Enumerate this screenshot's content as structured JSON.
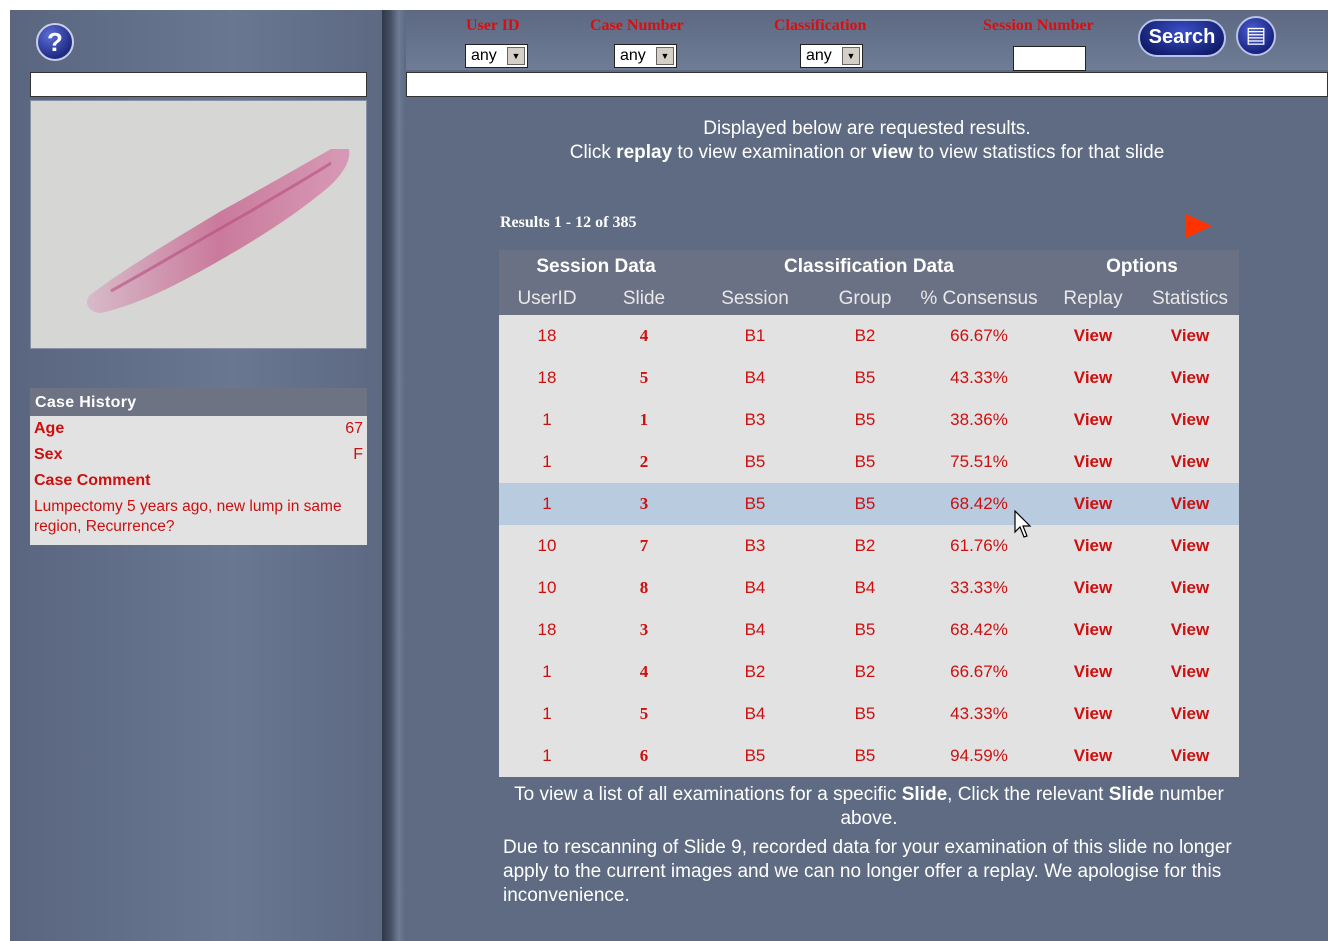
{
  "filters": {
    "user_id_label": "User ID",
    "case_number_label": "Case Number",
    "classification_label": "Classification",
    "session_number_label": "Session Number",
    "user_id_value": "any",
    "case_number_value": "any",
    "classification_value": "any",
    "search_label": "Search"
  },
  "intro": {
    "line1": "Displayed below are requested results.",
    "line2_pre": "Click ",
    "replay_word": "replay",
    "line2_mid": " to view examination or ",
    "view_word": "view",
    "line2_post": " to view statistics for that slide"
  },
  "results_count": "Results 1 - 12 of 385",
  "table": {
    "group_headers": [
      "Session Data",
      "Classification Data",
      "Options"
    ],
    "columns": [
      "UserID",
      "Slide",
      "Session",
      "Group",
      "% Consensus",
      "Replay",
      "Statistics"
    ],
    "rows": [
      {
        "user": "18",
        "slide": "4",
        "session": "B1",
        "group": "B2",
        "consensus": "66.67%",
        "replay": "View",
        "stats": "View"
      },
      {
        "user": "18",
        "slide": "5",
        "session": "B4",
        "group": "B5",
        "consensus": "43.33%",
        "replay": "View",
        "stats": "View"
      },
      {
        "user": "1",
        "slide": "1",
        "session": "B3",
        "group": "B5",
        "consensus": "38.36%",
        "replay": "View",
        "stats": "View"
      },
      {
        "user": "1",
        "slide": "2",
        "session": "B5",
        "group": "B5",
        "consensus": "75.51%",
        "replay": "View",
        "stats": "View"
      },
      {
        "user": "1",
        "slide": "3",
        "session": "B5",
        "group": "B5",
        "consensus": "68.42%",
        "replay": "View",
        "stats": "View"
      },
      {
        "user": "10",
        "slide": "7",
        "session": "B3",
        "group": "B2",
        "consensus": "61.76%",
        "replay": "View",
        "stats": "View"
      },
      {
        "user": "10",
        "slide": "8",
        "session": "B4",
        "group": "B4",
        "consensus": "33.33%",
        "replay": "View",
        "stats": "View"
      },
      {
        "user": "18",
        "slide": "3",
        "session": "B4",
        "group": "B5",
        "consensus": "68.42%",
        "replay": "View",
        "stats": "View"
      },
      {
        "user": "1",
        "slide": "4",
        "session": "B2",
        "group": "B2",
        "consensus": "66.67%",
        "replay": "View",
        "stats": "View"
      },
      {
        "user": "1",
        "slide": "5",
        "session": "B4",
        "group": "B5",
        "consensus": "43.33%",
        "replay": "View",
        "stats": "View"
      },
      {
        "user": "1",
        "slide": "6",
        "session": "B5",
        "group": "B5",
        "consensus": "94.59%",
        "replay": "View",
        "stats": "View"
      }
    ]
  },
  "notes": {
    "slide_note_pre": "To view a list of all examinations for a specific ",
    "slide_word": "Slide",
    "slide_note_mid": ", Click the relevant ",
    "slide_word2": "Slide",
    "slide_note_post": " number above.",
    "rescan_note": "Due to rescanning of Slide 9, recorded data for your examination of this slide no longer apply to the current images and we can no longer offer a replay. We apologise for this inconvenience."
  },
  "case_history": {
    "title": "Case History",
    "age_label": "Age",
    "age_value": "67",
    "sex_label": "Sex",
    "sex_value": "F",
    "comment_label": "Case Comment",
    "comment": "Lumpectomy 5 years ago, new lump in same region, Recurrence?"
  },
  "icons": {
    "help": "help-icon",
    "notes": "notes-icon",
    "next": "next-page-arrow-icon"
  },
  "colors": {
    "accent_red": "#cc1010",
    "background": "#5e6b82",
    "header_gray": "#6b7184",
    "highlight_row": "#b9cbdf"
  }
}
